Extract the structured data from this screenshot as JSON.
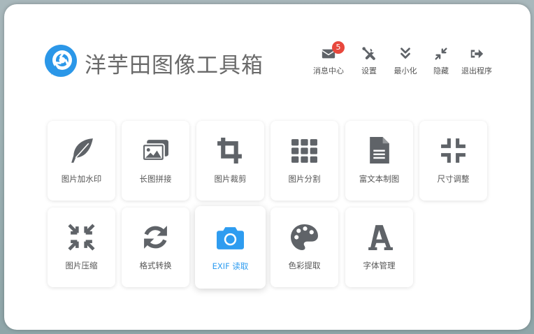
{
  "app": {
    "title": "洋芋田图像工具箱"
  },
  "toolbar": {
    "messages_label": "消息中心",
    "messages_badge": "5",
    "settings_label": "设置",
    "minimize_label": "最小化",
    "hide_label": "隐藏",
    "exit_label": "退出程序"
  },
  "tools": [
    {
      "label": "图片加水印",
      "icon": "feather-icon"
    },
    {
      "label": "长图拼接",
      "icon": "images-icon"
    },
    {
      "label": "图片裁剪",
      "icon": "crop-icon"
    },
    {
      "label": "图片分割",
      "icon": "grid-icon"
    },
    {
      "label": "富文本制图",
      "icon": "document-icon"
    },
    {
      "label": "尺寸调整",
      "icon": "compress-icon"
    },
    {
      "label": "图片压缩",
      "icon": "compress-arrows-icon"
    },
    {
      "label": "格式转换",
      "icon": "refresh-icon"
    },
    {
      "label": "EXIF 读取",
      "icon": "camera-icon",
      "active": true
    },
    {
      "label": "色彩提取",
      "icon": "palette-icon"
    },
    {
      "label": "字体管理",
      "icon": "font-icon"
    }
  ],
  "colors": {
    "accent": "#2e9cf0",
    "icon": "#5f6368",
    "badge": "#e8473c",
    "label": "#555555"
  }
}
